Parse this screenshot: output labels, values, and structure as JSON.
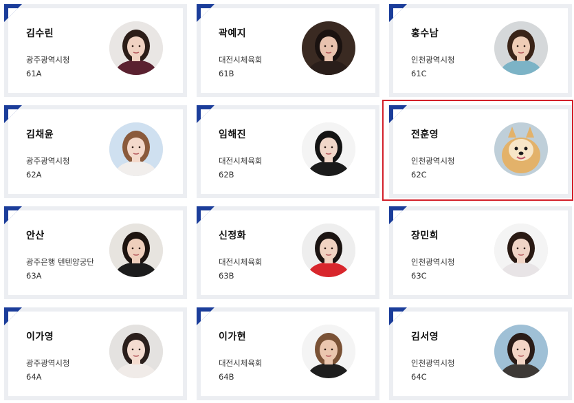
{
  "athletes": [
    {
      "name": "김수린",
      "team": "광주광역시청",
      "number": "61A",
      "avatar": "person-photo-icon",
      "bg": "#e9e6e4",
      "hair": "#2b1d18",
      "skin": "#f0d2c2",
      "shirt": "#5a2130"
    },
    {
      "name": "곽예지",
      "team": "대전시체육회",
      "number": "61B",
      "avatar": "person-photo-icon",
      "bg": "#3a2a22",
      "hair": "#1a1210",
      "skin": "#e8c2ae",
      "shirt": "#2a1e1a"
    },
    {
      "name": "홍수남",
      "team": "인천광역시청",
      "number": "61C",
      "avatar": "person-photo-icon",
      "bg": "#d5d8da",
      "hair": "#3a2418",
      "skin": "#efcdb6",
      "shirt": "#7cb3c6"
    },
    {
      "name": "김채윤",
      "team": "광주광역시청",
      "number": "62A",
      "avatar": "person-photo-icon",
      "bg": "#cfe0f0",
      "hair": "#8a5a3c",
      "skin": "#f4d9cb",
      "shirt": "#f1eeec"
    },
    {
      "name": "임해진",
      "team": "대전시체육회",
      "number": "62B",
      "avatar": "person-photo-icon",
      "bg": "#f4f4f4",
      "hair": "#141414",
      "skin": "#f1d7c9",
      "shirt": "#1b1b1b"
    },
    {
      "name": "전훈영",
      "team": "인천광역시청",
      "number": "62C",
      "avatar": "dog-photo-icon",
      "bg": "#bfcfd9",
      "hair": "#e3b26a",
      "skin": "#f7e6c8",
      "shirt": "#c4965c"
    },
    {
      "name": "안산",
      "team": "광주은행 텐텐양궁단",
      "number": "63A",
      "avatar": "person-photo-icon",
      "bg": "#e7e4df",
      "hair": "#1d1410",
      "skin": "#efcfbc",
      "shirt": "#1c1c1c"
    },
    {
      "name": "신정화",
      "team": "대전시체육회",
      "number": "63B",
      "avatar": "person-photo-icon",
      "bg": "#eeeeee",
      "hair": "#1b1412",
      "skin": "#f1d3c2",
      "shirt": "#d8262c"
    },
    {
      "name": "장민희",
      "team": "인천광역시청",
      "number": "63C",
      "avatar": "person-photo-icon",
      "bg": "#f4f4f4",
      "hair": "#2a1a14",
      "skin": "#f0d4c6",
      "shirt": "#e8e4e6"
    },
    {
      "name": "이가영",
      "team": "광주광역시청",
      "number": "64A",
      "avatar": "person-photo-icon",
      "bg": "#e4e2e0",
      "hair": "#2a1f1c",
      "skin": "#f4dcd0",
      "shirt": "#f0ebe8"
    },
    {
      "name": "이가현",
      "team": "대전시체육회",
      "number": "64B",
      "avatar": "person-photo-icon",
      "bg": "#f4f4f4",
      "hair": "#7a5236",
      "skin": "#ebc6ae",
      "shirt": "#1e1e1e"
    },
    {
      "name": "김서영",
      "team": "인천광역시청",
      "number": "64C",
      "avatar": "person-photo-icon",
      "bg": "#9fc0d6",
      "hair": "#2a1c18",
      "skin": "#f3d5c6",
      "shirt": "#3d3936"
    }
  ],
  "selected_index": 5,
  "colors": {
    "accent": "#1b3d9a",
    "card_border": "#eceef2",
    "selected_outline": "#d3202a"
  }
}
